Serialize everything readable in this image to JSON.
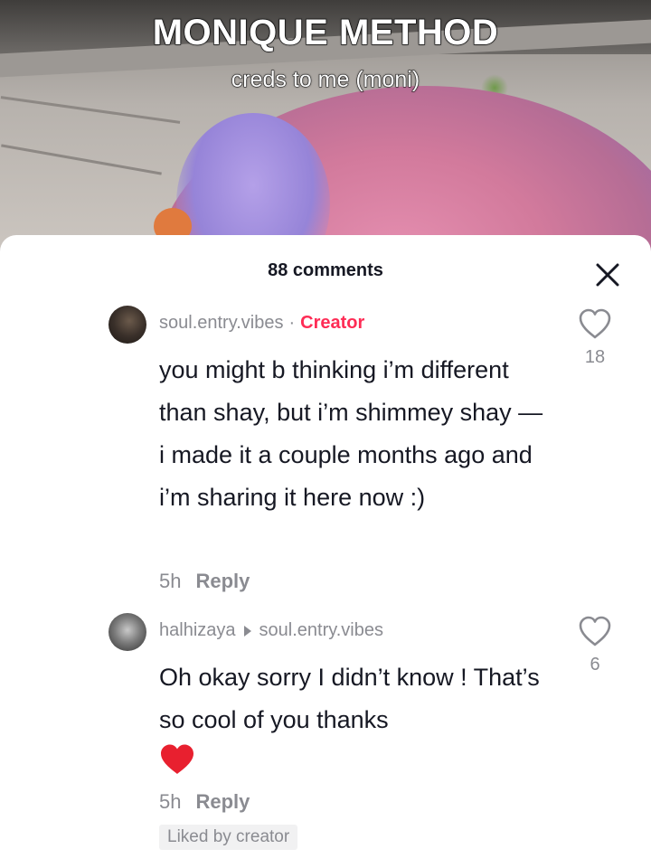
{
  "video": {
    "title": "MONIQUE METHOD",
    "subtitle": "creds to me (moni)"
  },
  "sheet": {
    "comments_count": "88 comments",
    "close_icon": "close-icon"
  },
  "comments": [
    {
      "username": "soul.entry.vibes",
      "separator": "·",
      "badge": "Creator",
      "text": "you might b thinking i’m different than shay, but i’m shimmey shay — i made it a couple months ago and i’m sharing it here now :)",
      "time": "5h",
      "reply_label": "Reply",
      "likes": "18"
    },
    {
      "username": "halhizaya",
      "reply_to": "soul.entry.vibes",
      "text": "Oh okay sorry I didn’t know ! That’s so cool of you thanks",
      "emoji": "heart-emoji",
      "time": "5h",
      "reply_label": "Reply",
      "likes": "6",
      "liked_by": "Liked by creator"
    }
  ],
  "colors": {
    "accent": "#fe2c55",
    "text_primary": "#161823",
    "text_secondary": "#8a8b91"
  }
}
